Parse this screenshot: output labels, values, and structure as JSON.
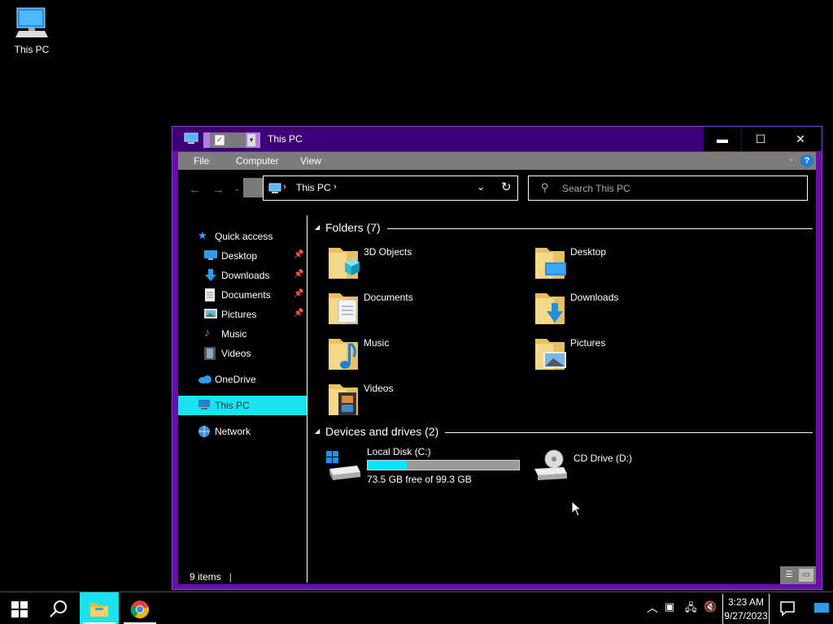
{
  "desktop": {
    "icon_label": "This PC"
  },
  "window": {
    "title": "This PC",
    "controls": {
      "minimize": "▬",
      "maximize": "☐",
      "close": "✕"
    },
    "menu": {
      "file": "File",
      "computer": "Computer",
      "view": "View",
      "help": "?"
    },
    "address": {
      "crumb": "This PC",
      "separator": "›"
    },
    "search_placeholder": "Search This PC",
    "status": {
      "items": "9 items"
    }
  },
  "sidebar": {
    "quick_access": "Quick access",
    "items": [
      {
        "label": "Desktop",
        "pinned": true
      },
      {
        "label": "Downloads",
        "pinned": true
      },
      {
        "label": "Documents",
        "pinned": true
      },
      {
        "label": "Pictures",
        "pinned": true
      },
      {
        "label": "Music",
        "pinned": false
      },
      {
        "label": "Videos",
        "pinned": false
      }
    ],
    "onedrive": "OneDrive",
    "this_pc": "This PC",
    "network": "Network"
  },
  "main": {
    "folders_header": "Folders (7)",
    "folders": [
      {
        "name": "3D Objects",
        "icon": "3d-objects-folder-icon"
      },
      {
        "name": "Desktop",
        "icon": "desktop-folder-icon"
      },
      {
        "name": "Documents",
        "icon": "documents-folder-icon"
      },
      {
        "name": "Downloads",
        "icon": "downloads-folder-icon"
      },
      {
        "name": "Music",
        "icon": "music-folder-icon"
      },
      {
        "name": "Pictures",
        "icon": "pictures-folder-icon"
      },
      {
        "name": "Videos",
        "icon": "videos-folder-icon"
      }
    ],
    "devices_header": "Devices and drives (2)",
    "drives": [
      {
        "name": "Local Disk (C:)",
        "free": "73.5 GB free of 99.3 GB",
        "used_fraction": 0.26
      },
      {
        "name": "CD Drive (D:)"
      }
    ]
  },
  "taskbar": {
    "time": "3:23 AM",
    "date": "9/27/2023"
  },
  "colors": {
    "accent": "#1ae2f0",
    "title_bar": "#3d0078",
    "window_border": "#6a0dad"
  }
}
